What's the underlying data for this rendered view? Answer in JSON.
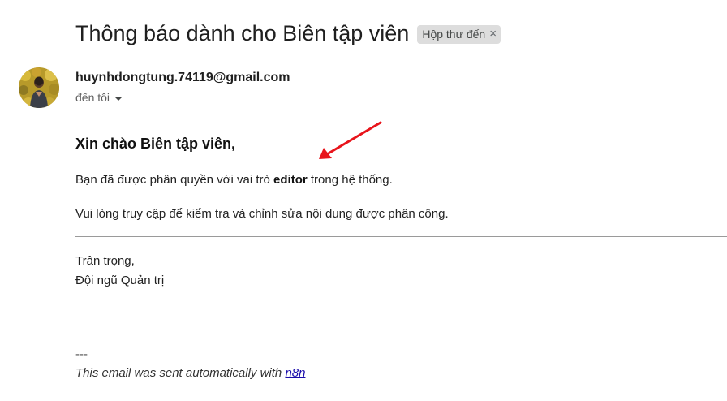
{
  "email": {
    "subject": "Thông báo dành cho Biên tập viên",
    "label": "Hộp thư đến",
    "label_close": "×",
    "sender_email": "huynhdongtung.74119@gmail.com",
    "recipient": "đến tôi",
    "body": {
      "greeting": "Xin chào Biên tập viên,",
      "line1_prefix": "Bạn đã được phân quyền với vai trò ",
      "line1_role": "editor",
      "line1_suffix": " trong hệ thống.",
      "line2": "Vui lòng truy cập để kiểm tra và chỉnh sửa nội dung được phân công.",
      "signoff": "Trân trọng,",
      "team": "Đội ngũ Quản trị",
      "footer_dash": "---",
      "footer_text": "This email was sent automatically with ",
      "footer_link": "n8n"
    }
  },
  "colors": {
    "arrow": "#e8141b",
    "link": "#1a0dab",
    "chip_bg": "#dddddd"
  },
  "icons": {
    "avatar": "profile-photo",
    "caret": "caret-down-icon",
    "annotation": "red-arrow-annotation"
  }
}
